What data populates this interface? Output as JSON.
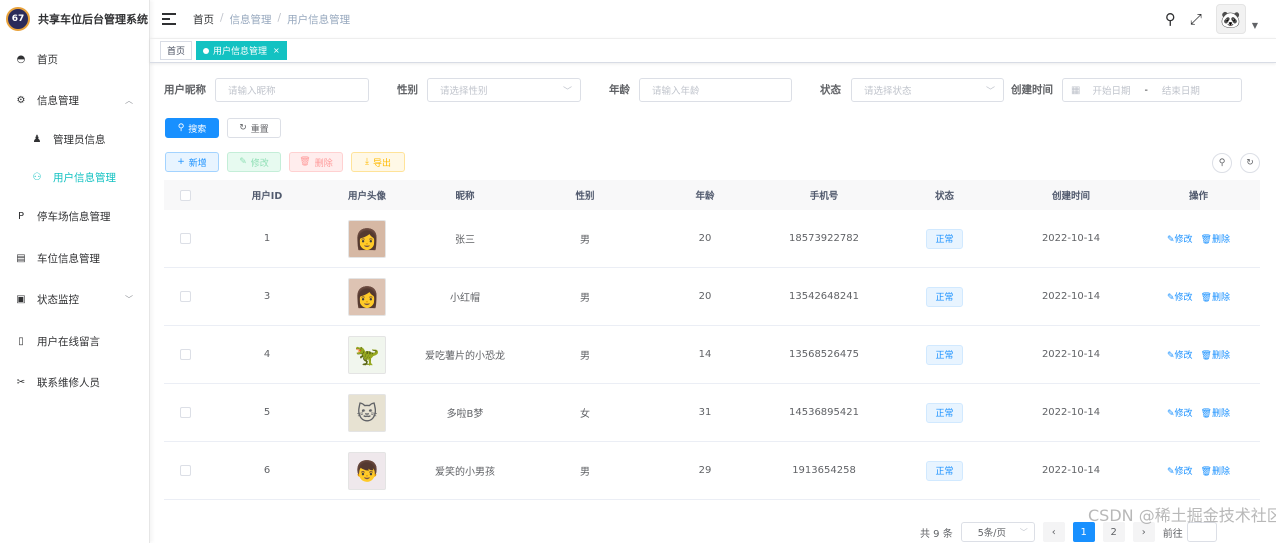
{
  "app": {
    "title": "共享车位后台管理系统",
    "logo_text": "67"
  },
  "sidebar": {
    "items": [
      {
        "label": "首页",
        "icon": "dashboard-icon"
      },
      {
        "label": "信息管理",
        "icon": "gear-icon",
        "expanded": true
      },
      {
        "label": "管理员信息",
        "icon": "admin-user-icon"
      },
      {
        "label": "用户信息管理",
        "icon": "user-icon"
      },
      {
        "label": "停车场信息管理",
        "icon": "parking-icon"
      },
      {
        "label": "车位信息管理",
        "icon": "document-icon"
      },
      {
        "label": "状态监控",
        "icon": "monitor-icon"
      },
      {
        "label": "用户在线留言",
        "icon": "message-icon"
      },
      {
        "label": "联系维修人员",
        "icon": "tool-icon"
      }
    ]
  },
  "header": {
    "breadcrumb": [
      "首页",
      "信息管理",
      "用户信息管理"
    ],
    "icons": [
      "search-icon",
      "fullscreen-icon"
    ]
  },
  "tags": {
    "items": [
      {
        "label": "首页",
        "active": false
      },
      {
        "label": "用户信息管理",
        "active": true,
        "close": "×"
      }
    ]
  },
  "search": {
    "nickname_label": "用户昵称",
    "nickname_placeholder": "请输入昵称",
    "gender_label": "性别",
    "gender_placeholder": "请选择性别",
    "age_label": "年龄",
    "age_placeholder": "请输入年龄",
    "status_label": "状态",
    "status_placeholder": "请选择状态",
    "created_label": "创建时间",
    "start_placeholder": "开始日期",
    "range_sep": "-",
    "end_placeholder": "结束日期",
    "search_btn": "搜索",
    "reset_btn": "重置"
  },
  "toolbar": {
    "add": "新增",
    "edit": "修改",
    "delete": "删除",
    "export": "导出"
  },
  "table": {
    "headers": [
      "用户ID",
      "用户头像",
      "昵称",
      "性别",
      "年龄",
      "手机号",
      "状态",
      "创建时间",
      "操作"
    ],
    "rows": [
      {
        "id": "1",
        "nickname": "张三",
        "gender": "男",
        "age": "20",
        "phone": "18573922782",
        "status": "正常",
        "created": "2022-10-14",
        "edit": "修改",
        "delete": "删除"
      },
      {
        "id": "3",
        "nickname": "小红帽",
        "gender": "男",
        "age": "20",
        "phone": "13542648241",
        "status": "正常",
        "created": "2022-10-14",
        "edit": "修改",
        "delete": "删除"
      },
      {
        "id": "4",
        "nickname": "爱吃薯片的小恐龙",
        "gender": "男",
        "age": "14",
        "phone": "13568526475",
        "status": "正常",
        "created": "2022-10-14",
        "edit": "修改",
        "delete": "删除"
      },
      {
        "id": "5",
        "nickname": "多啦B梦",
        "gender": "女",
        "age": "31",
        "phone": "14536895421",
        "status": "正常",
        "created": "2022-10-14",
        "edit": "修改",
        "delete": "删除"
      },
      {
        "id": "6",
        "nickname": "爱笑的小男孩",
        "gender": "男",
        "age": "29",
        "phone": "1913654258",
        "status": "正常",
        "created": "2022-10-14",
        "edit": "修改",
        "delete": "删除"
      }
    ]
  },
  "pagination": {
    "total": "共 9 条",
    "page_size": "5条/页",
    "pages": [
      "1",
      "2"
    ],
    "current_page": 1,
    "goto_label": "前往"
  },
  "watermark": "CSDN @稀土掘金技术社区"
}
